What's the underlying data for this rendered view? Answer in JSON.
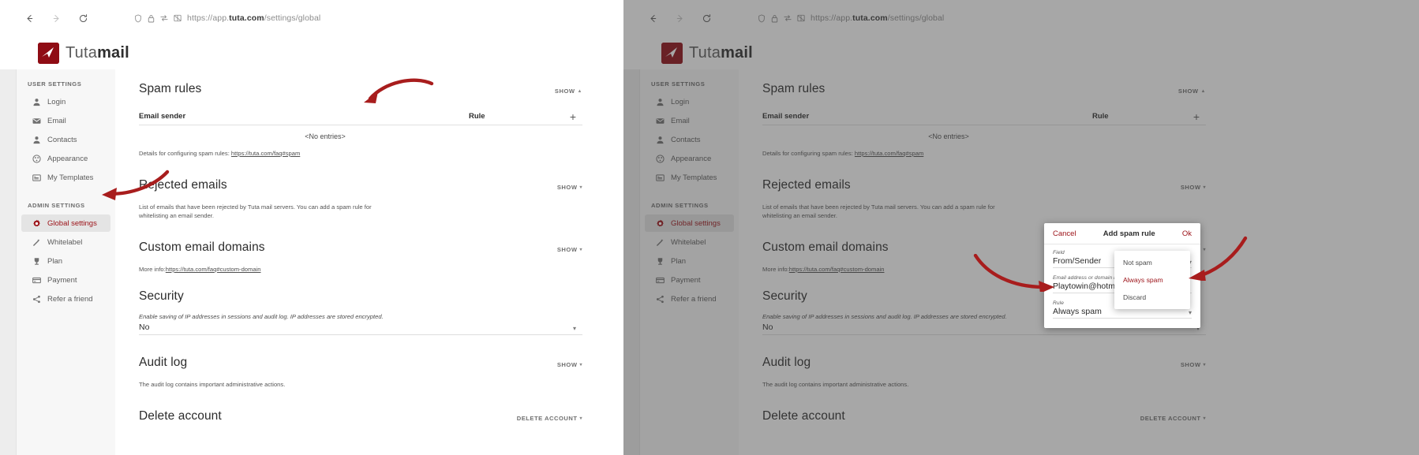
{
  "browser": {
    "back_icon": "back-arrow-icon",
    "forward_icon": "forward-arrow-icon",
    "reload_icon": "reload-icon",
    "shield_icon": "shield-icon",
    "lock_icon": "lock-icon",
    "sync_icon": "sync-icon",
    "reader_icon": "reader-mode-icon",
    "url_prefix": "https://app.",
    "url_domain": "tuta.com",
    "url_path": "/settings/global"
  },
  "app": {
    "logo_text_light": "Tuta",
    "logo_text_bold": "mail"
  },
  "sidebar": {
    "user_settings_header": "USER SETTINGS",
    "admin_settings_header": "ADMIN SETTINGS",
    "user_items": [
      {
        "label": "Login",
        "icon": "person-icon"
      },
      {
        "label": "Email",
        "icon": "envelope-icon"
      },
      {
        "label": "Contacts",
        "icon": "person-icon"
      },
      {
        "label": "Appearance",
        "icon": "palette-icon"
      },
      {
        "label": "My Templates",
        "icon": "template-icon"
      }
    ],
    "admin_items": [
      {
        "label": "Global settings",
        "icon": "gear-icon",
        "active": true
      },
      {
        "label": "Whitelabel",
        "icon": "wand-icon",
        "active": false
      },
      {
        "label": "Plan",
        "icon": "trophy-icon",
        "active": false
      },
      {
        "label": "Payment",
        "icon": "credit-card-icon",
        "active": false
      },
      {
        "label": "Refer a friend",
        "icon": "share-icon",
        "active": false
      }
    ]
  },
  "main": {
    "spam_rules": {
      "title": "Spam rules",
      "show_label": "SHOW",
      "caret": "▲",
      "col_sender": "Email sender",
      "col_rule": "Rule",
      "add_icon": "plus-icon",
      "empty": "<No entries>",
      "hint_prefix": "Details for configuring spam rules: ",
      "hint_link": "https://tuta.com/faq#spam"
    },
    "rejected_emails": {
      "title": "Rejected emails",
      "show_label": "SHOW",
      "caret": "▾",
      "description": "List of emails that have been rejected by Tuta mail servers. You can add a spam rule for whitelisting an email sender."
    },
    "custom_domains": {
      "title": "Custom email domains",
      "show_label": "SHOW",
      "caret": "▾",
      "hint_prefix": "More info:",
      "hint_link": "https://tuta.com/faq#custom-domain"
    },
    "security": {
      "title": "Security",
      "description": "Enable saving of IP addresses in sessions and audit log. IP addresses are stored encrypted.",
      "value": "No",
      "caret": "▾"
    },
    "audit_log": {
      "title": "Audit log",
      "show_label": "SHOW",
      "caret": "▾",
      "description": "The audit log contains important administrative actions."
    },
    "delete_account": {
      "title": "Delete account",
      "action_label": "DELETE ACCOUNT",
      "caret": "▾"
    }
  },
  "modal": {
    "cancel_label": "Cancel",
    "title": "Add spam rule",
    "ok_label": "Ok",
    "field_label": "Field",
    "field_value": "From/Sender",
    "email_label": "Email address or domain name",
    "email_value": "Playtowin@hotmail.com",
    "rule_label": "Rule",
    "rule_value": "Always spam",
    "caret": "▾",
    "dropdown_options": [
      {
        "label": "Not spam",
        "selected": false
      },
      {
        "label": "Always spam",
        "selected": true
      },
      {
        "label": "Discard",
        "selected": false
      }
    ]
  },
  "annotations": {
    "arrow_color": "#a81d1d",
    "arrow_to_plus": "arrow-annotation-plus-button",
    "arrow_to_global_settings": "arrow-annotation-global-settings",
    "arrow_to_email_field": "arrow-annotation-email-field",
    "arrow_to_dropdown": "arrow-annotation-rule-dropdown"
  }
}
